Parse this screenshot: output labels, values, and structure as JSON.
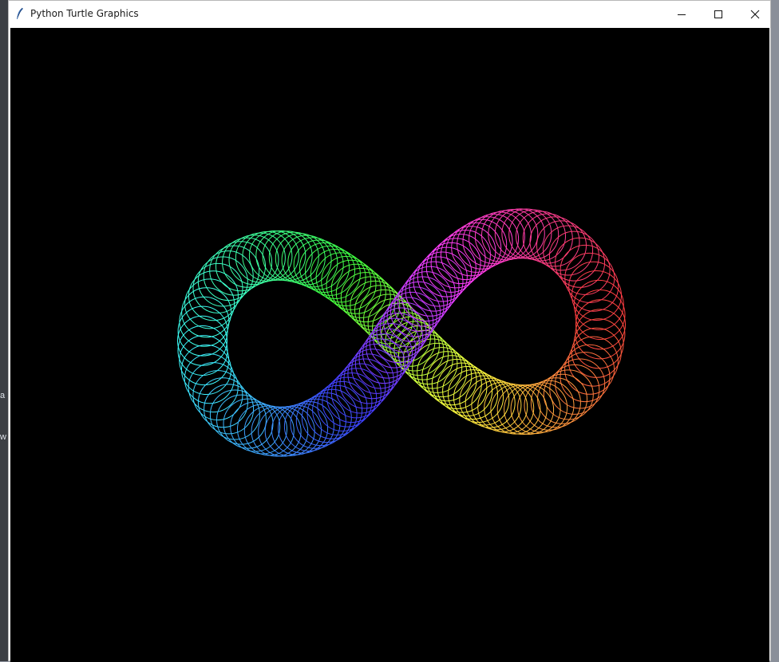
{
  "window": {
    "title": "Python Turtle Graphics"
  },
  "background_fragments": [
    "a",
    "w"
  ],
  "canvas": {
    "background_color": "#000000",
    "drawing": "rainbow spirograph infinity figure"
  },
  "controls": {
    "minimize_icon": "minimize-icon",
    "maximize_icon": "maximize-icon",
    "close_icon": "close-icon"
  }
}
